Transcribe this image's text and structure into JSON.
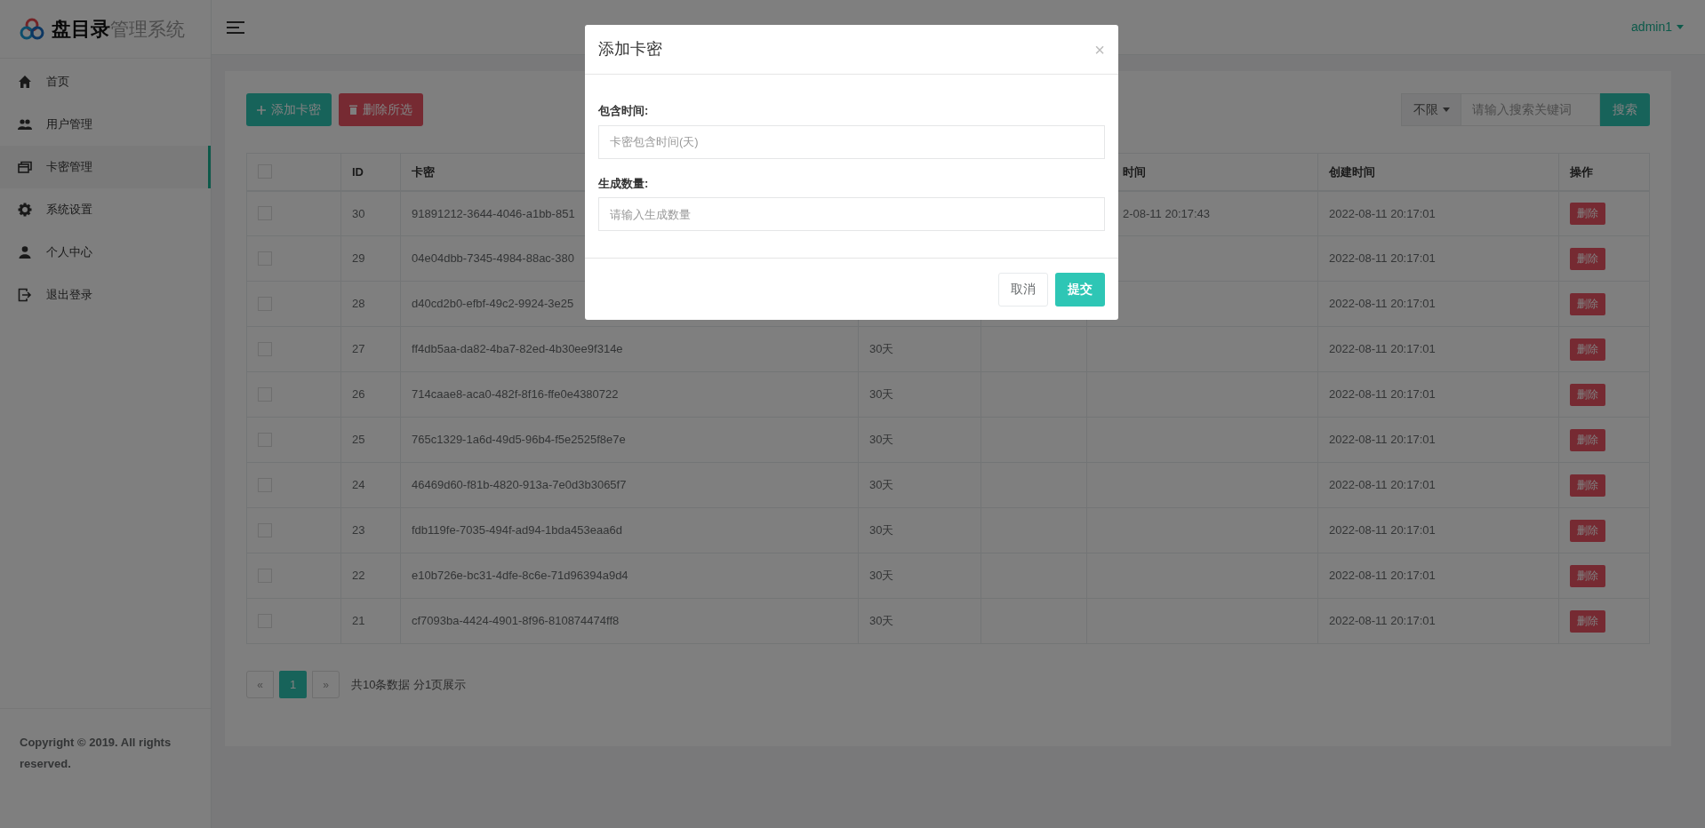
{
  "sidebar": {
    "logo": {
      "brand": "盘目录",
      "suffix": "管理系统"
    },
    "items": [
      {
        "label": "首页",
        "selected": false
      },
      {
        "label": "用户管理",
        "selected": false
      },
      {
        "label": "卡密管理",
        "selected": true
      },
      {
        "label": "系统设置",
        "selected": false
      },
      {
        "label": "个人中心",
        "selected": false
      },
      {
        "label": "退出登录",
        "selected": false
      }
    ],
    "copyright": "Copyright © 2019. All rights reserved."
  },
  "header": {
    "user": "admin1"
  },
  "toolbar": {
    "add_button": "添加卡密",
    "delete_button": "删除所选"
  },
  "search": {
    "filter": "不限",
    "placeholder": "请输入搜索关键词",
    "button": "搜索"
  },
  "table": {
    "header": {
      "checked": false,
      "id": "ID",
      "key": "卡密",
      "column_6": "时间",
      "created": "创建时间",
      "action": "操作"
    },
    "rows": [
      {
        "checked": false,
        "id": "30",
        "key": "91891212-3644-4046-a1bb-851",
        "column_6": "2-08-11 20:17:43",
        "created": "2022-08-11 20:17:01",
        "action": "删除"
      },
      {
        "checked": false,
        "id": "29",
        "key": "04e04dbb-7345-4984-88ac-380",
        "created": "2022-08-11 20:17:01",
        "action": "删除"
      },
      {
        "checked": false,
        "id": "28",
        "key": "d40cd2b0-efbf-49c2-9924-3e25",
        "created": "2022-08-11 20:17:01",
        "action": "删除"
      },
      {
        "checked": false,
        "id": "27",
        "key": "ff4db5aa-da82-4ba7-82ed-4b30ee9f314e",
        "column_4": "30天",
        "created": "2022-08-11 20:17:01",
        "action": "删除"
      },
      {
        "checked": false,
        "id": "26",
        "key": "714caae8-aca0-482f-8f16-ffe0e4380722",
        "column_4": "30天",
        "created": "2022-08-11 20:17:01",
        "action": "删除"
      },
      {
        "checked": false,
        "id": "25",
        "key": "765c1329-1a6d-49d5-96b4-f5e2525f8e7e",
        "column_4": "30天",
        "created": "2022-08-11 20:17:01",
        "action": "删除"
      },
      {
        "checked": false,
        "id": "24",
        "key": "46469d60-f81b-4820-913a-7e0d3b3065f7",
        "column_4": "30天",
        "created": "2022-08-11 20:17:01",
        "action": "删除"
      },
      {
        "checked": false,
        "id": "23",
        "key": "fdb119fe-7035-494f-ad94-1bda453eaa6d",
        "column_4": "30天",
        "created": "2022-08-11 20:17:01",
        "action": "删除"
      },
      {
        "checked": false,
        "id": "22",
        "key": "e10b726e-bc31-4dfe-8c6e-71d96394a9d4",
        "column_4": "30天",
        "created": "2022-08-11 20:17:01",
        "action": "删除"
      },
      {
        "checked": false,
        "id": "21",
        "key": "cf7093ba-4424-4901-8f96-810874474ff8",
        "column_4": "30天",
        "created": "2022-08-11 20:17:01",
        "action": "删除"
      }
    ]
  },
  "pagination": {
    "prev": "«",
    "pages": [
      {
        "label": "1",
        "selected": true
      }
    ],
    "next": "»",
    "summary": "共10条数据 分1页展示"
  },
  "modal": {
    "title": "添加卡密",
    "close": "×",
    "fields": [
      {
        "label": "包含时间:",
        "placeholder": "卡密包含时间(天)"
      },
      {
        "label": "生成数量:",
        "placeholder": "请输入生成数量"
      }
    ],
    "cancel": "取消",
    "submit": "提交"
  }
}
